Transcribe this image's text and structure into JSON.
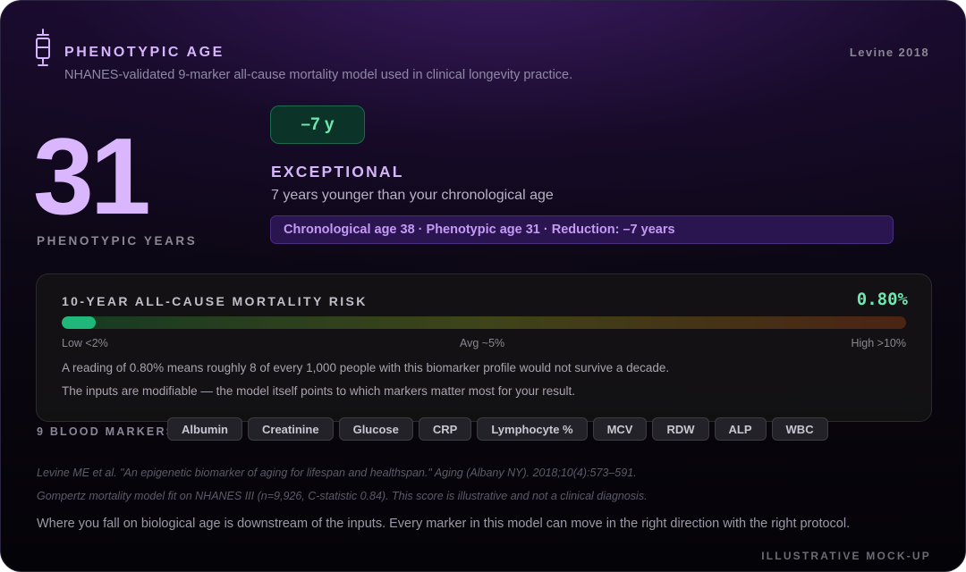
{
  "header": {
    "title": "PHENOTYPIC AGE",
    "subtitle": "NHANES-validated 9-marker all-cause mortality model used in clinical longevity practice.",
    "reference": "Levine 2018",
    "icon": "test-tube-icon"
  },
  "score": {
    "value": "31",
    "label": "PHENOTYPIC YEARS"
  },
  "result": {
    "delta": "–7 y",
    "tier": "EXCEPTIONAL",
    "description": "7 years younger than your chronological age",
    "summary": "Chronological age 38 · Phenotypic age 31 · Reduction: –7 years"
  },
  "risk": {
    "title": "10-YEAR ALL-CAUSE MORTALITY RISK",
    "value_label": "0.80%",
    "fill_fraction": 0.04,
    "scale": {
      "low": "Low <2%",
      "avg": "Avg ~5%",
      "high": "High >10%"
    },
    "note1": "A reading of 0.80% means roughly 8 of every 1,000 people with this biomarker profile would not survive a decade.",
    "note2": "The inputs are modifiable — the model itself points to which markers matter most for your result."
  },
  "markers": {
    "label": "9 BLOOD MARKERS",
    "items": [
      "Albumin",
      "Creatinine",
      "Glucose",
      "CRP",
      "Lymphocyte %",
      "MCV",
      "RDW",
      "ALP",
      "WBC"
    ]
  },
  "citations": {
    "line1": "Levine ME et al. \"An epigenetic biomarker of aging for lifespan and healthspan.\" Aging (Albany NY). 2018;10(4):573–591.",
    "line2": "Gompertz mortality model fit on NHANES III (n=9,926, C-statistic 0.84). This score is illustrative and not a clinical diagnosis."
  },
  "footer": {
    "text": "Where you fall on biological age is downstream of the inputs. Every marker in this model can move in the right direction with the right protocol.",
    "badge": "ILLUSTRATIVE MOCK-UP"
  },
  "colors": {
    "accent": "#d6b4fb",
    "success": "#6ee7b0",
    "bar_fill": "#1fb87a"
  }
}
